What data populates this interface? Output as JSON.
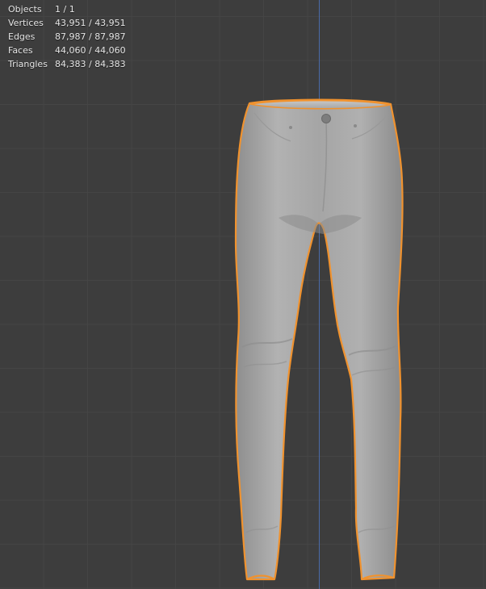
{
  "overlay": {
    "stats": [
      {
        "label": "Objects",
        "value": "1 / 1"
      },
      {
        "label": "Vertices",
        "value": "43,951 / 43,951"
      },
      {
        "label": "Edges",
        "value": "87,987 / 87,987"
      },
      {
        "label": "Faces",
        "value": "44,060 / 44,060"
      },
      {
        "label": "Triangles",
        "value": "84,383 / 84,383"
      }
    ]
  },
  "colors": {
    "background": "#3d3d3d",
    "grid": "#454545",
    "z_axis": "#4a6aa8",
    "selection_outline": "#f0922e",
    "mesh_fill": "#a9a9a9"
  }
}
